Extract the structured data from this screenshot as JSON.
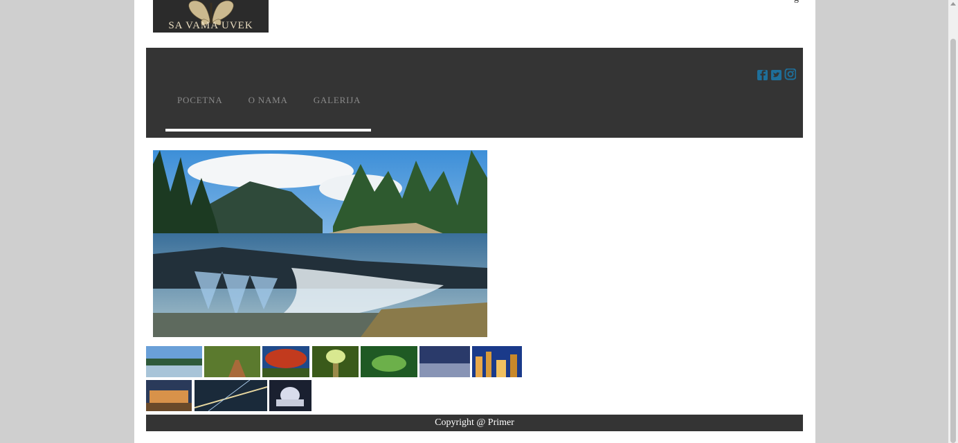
{
  "header": {
    "logo_text": "SA VAMA UVEK",
    "top_right_text": "g"
  },
  "nav": {
    "items": [
      {
        "label": "POCETNA"
      },
      {
        "label": "O NAMA"
      },
      {
        "label": "GALERIJA"
      }
    ]
  },
  "social": {
    "icons": [
      "facebook-icon",
      "twitter-icon",
      "instagram-icon"
    ],
    "color": "#1e6f9a"
  },
  "gallery": {
    "thumbnails": [
      "waterfall",
      "forest-path",
      "autumn-tree",
      "sunlit-forest",
      "mossy-stream",
      "city-night-aerial",
      "city-skyline",
      "lit-building-night",
      "city-lights-aerial",
      "domed-building-night"
    ]
  },
  "footer": {
    "text": "Copyright @ Primer"
  },
  "colors": {
    "page_bg": "#cfcfcf",
    "navbar_bg": "#343434",
    "footer_bg": "#343434",
    "nav_text": "#8a8a8a"
  }
}
